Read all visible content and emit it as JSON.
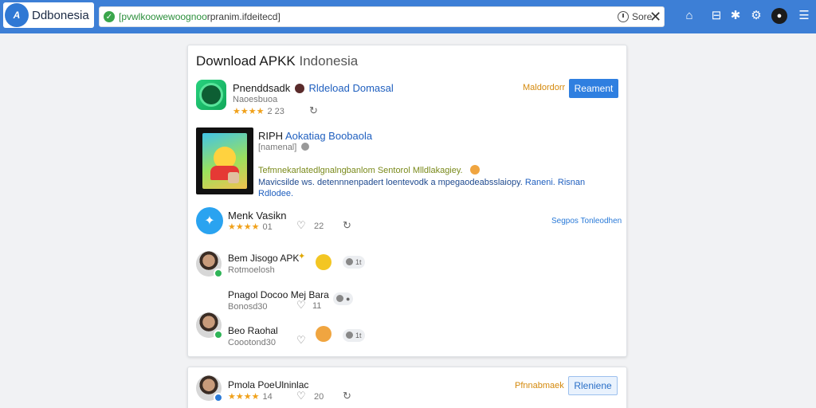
{
  "browser": {
    "brand_name": "Ddbonesia",
    "brand_logo_text": "A",
    "url_prefix": "[pvwlkoowewoognoo",
    "url_rest": "rpranim.ifdeitecd]",
    "url_action_label": "Sore",
    "accent_color": "#3d7fd6"
  },
  "page": {
    "title_main": "Download APKK",
    "title_light": "Indonesia"
  },
  "apps": {
    "top": {
      "name": "Pnenddsadk",
      "publisher": "Rldeload Domasal",
      "subtitle": "Naoesbuoa",
      "stars": "★★★★",
      "rating_count": "2 23",
      "tag": "Maldordorr",
      "button": "Reament"
    },
    "featured": {
      "title_dark": "RIPH",
      "title_blue": "Aokatiag Boobaola",
      "meta": "[namenal]",
      "desc_line1": "Tefmnekarlatedlgnalngbanlom Sentorol Mlldlakagiey.",
      "desc_line2": "Mavicsilde ws. detennnenpadert loentevodk a mpegaodeabsslaiopy.",
      "desc_blue_tail": "Raneni. Risnan",
      "desc_line3": "Rdlodee."
    },
    "third": {
      "name": "Menk Vasikn",
      "stars": "★★★★",
      "rating_count": "01",
      "likes": "22",
      "link": "Segpos Tonleodhen"
    }
  },
  "users": [
    {
      "name": "Bem Jisogo APK",
      "sub": "Rotmoelosh",
      "reacts": "1t"
    },
    {
      "name": "Pnagol Docoo Mej Bara",
      "sub": "Bonosd30",
      "likes": "11"
    },
    {
      "name": "Beo Raohal",
      "sub": "Coootond30",
      "reacts": "1t"
    }
  ],
  "bottom": {
    "name": "Pmola PoeUlninlac",
    "stars": "★★★★",
    "rating_count": "14",
    "likes": "20",
    "tag": "Pfnnabmaek",
    "button": "Rleniene"
  }
}
